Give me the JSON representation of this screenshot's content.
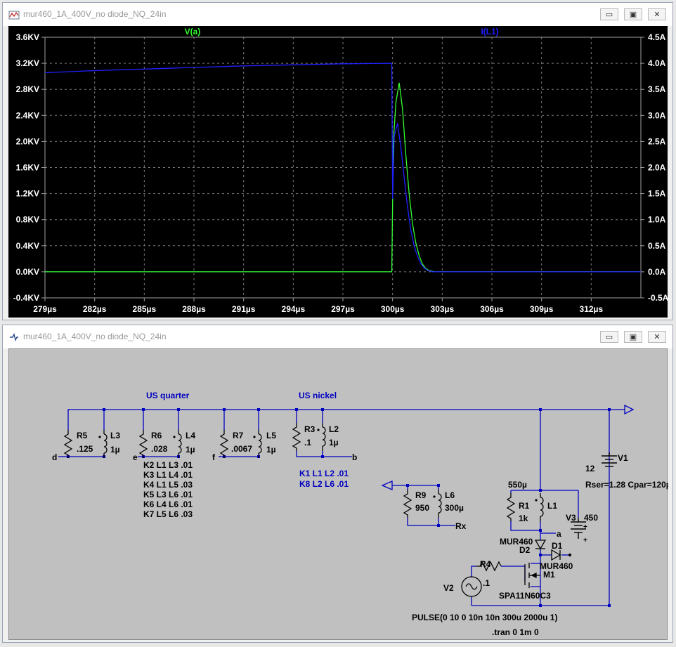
{
  "waveform_window": {
    "title": "mur460_1A_400V_no diode_NQ_24in",
    "buttons": {
      "minimize": "▭",
      "restore": "▣",
      "close": "✕"
    }
  },
  "schematic_window": {
    "title": "mur460_1A_400V_no diode_NQ_24in",
    "buttons": {
      "minimize": "▭",
      "restore": "▣",
      "close": "✕"
    }
  },
  "chart_data": {
    "type": "line",
    "xlabel": "",
    "x_unit": "µs",
    "xlim": [
      279,
      315
    ],
    "x_ticks": [
      "279µs",
      "282µs",
      "285µs",
      "288µs",
      "291µs",
      "294µs",
      "297µs",
      "300µs",
      "303µs",
      "306µs",
      "309µs",
      "312µs"
    ],
    "left_axis": {
      "ylim": [
        -0.4,
        3.6
      ],
      "ticks": [
        "-0.4KV",
        "0.0KV",
        "0.4KV",
        "0.8KV",
        "1.2KV",
        "1.6KV",
        "2.0KV",
        "2.4KV",
        "2.8KV",
        "3.2KV",
        "3.6KV"
      ]
    },
    "right_axis": {
      "ylim": [
        -0.5,
        4.5
      ],
      "ticks": [
        "-0.5A",
        "0.0A",
        "0.5A",
        "1.0A",
        "1.5A",
        "2.0A",
        "2.5A",
        "3.0A",
        "3.5A",
        "4.0A",
        "4.5A"
      ]
    },
    "grid": true,
    "series": [
      {
        "name": "V(a)",
        "color": "#33ff33",
        "axis": "left",
        "unit": "KV",
        "points": [
          [
            279,
            0
          ],
          [
            299.95,
            0
          ],
          [
            300.05,
            2.0
          ],
          [
            300.2,
            2.6
          ],
          [
            300.4,
            2.9
          ],
          [
            300.6,
            2.5
          ],
          [
            300.8,
            1.8
          ],
          [
            301.0,
            1.2
          ],
          [
            301.2,
            0.75
          ],
          [
            301.4,
            0.45
          ],
          [
            301.6,
            0.25
          ],
          [
            301.8,
            0.12
          ],
          [
            302.0,
            0.05
          ],
          [
            302.2,
            0.02
          ],
          [
            302.5,
            0
          ],
          [
            315,
            0
          ]
        ]
      },
      {
        "name": "I(L1)",
        "color": "#2020ff",
        "axis": "right",
        "unit": "A",
        "points": [
          [
            279,
            3.82
          ],
          [
            282,
            3.86
          ],
          [
            285,
            3.89
          ],
          [
            288,
            3.92
          ],
          [
            291,
            3.95
          ],
          [
            294,
            3.97
          ],
          [
            297,
            3.99
          ],
          [
            299.95,
            4.0
          ],
          [
            300.0,
            1.4
          ],
          [
            300.1,
            2.6
          ],
          [
            300.3,
            2.85
          ],
          [
            300.5,
            2.4
          ],
          [
            300.7,
            1.8
          ],
          [
            300.9,
            1.25
          ],
          [
            301.1,
            0.8
          ],
          [
            301.3,
            0.5
          ],
          [
            301.5,
            0.3
          ],
          [
            301.7,
            0.16
          ],
          [
            301.9,
            0.08
          ],
          [
            302.1,
            0.03
          ],
          [
            302.4,
            0
          ],
          [
            315,
            0
          ]
        ]
      }
    ]
  },
  "schematic": {
    "wire_color": "#0000c0",
    "comments": {
      "us_quarter": "US quarter",
      "us_nickel": "US nickel"
    },
    "components": {
      "R5": {
        "name": "R5",
        "value": ".125"
      },
      "L3": {
        "name": "L3",
        "value": "1µ"
      },
      "R6": {
        "name": "R6",
        "value": ".028"
      },
      "L4": {
        "name": "L4",
        "value": "1µ"
      },
      "R7": {
        "name": "R7",
        "value": ".0067"
      },
      "L5": {
        "name": "L5",
        "value": "1µ"
      },
      "R3": {
        "name": "R3",
        "value": ".1"
      },
      "L2": {
        "name": "L2",
        "value": "1µ"
      },
      "R9": {
        "name": "R9",
        "value": "950"
      },
      "L6": {
        "name": "L6",
        "value": "300µ"
      },
      "R1": {
        "name": "R1",
        "value": "1k"
      },
      "L1": {
        "name": "L1",
        "value": "550µ"
      },
      "V1": {
        "name": "V1",
        "value": "12"
      },
      "V3": {
        "name": "V3",
        "value": "450"
      },
      "D1": {
        "name": "D1",
        "value": "MUR460"
      },
      "D2": {
        "name": "D2",
        "value": "MUR460"
      },
      "M1": {
        "name": "M1",
        "value": "SPA11N60C3"
      },
      "R4": {
        "name": "R4",
        "value": ".1"
      },
      "V2": {
        "name": "V2",
        "value": "PULSE(0 10 0 10n 10n 300u 2000u 1)"
      }
    },
    "nets": {
      "d": "d",
      "e": "e",
      "f": "f",
      "b": "b",
      "a": "a",
      "rx": "Rx"
    },
    "k_black": [
      "K2 L1 L3 .01",
      "K3 L1 L4 .01",
      "K4 L1 L5 .03",
      "K5 L3 L6 .01",
      "K6 L4 L6 .01",
      "K7 L5 L6 .03"
    ],
    "k_blue": [
      "K1 L1 L2 .01",
      "K8 L2 L6 .01"
    ],
    "rser_cpar": "Rser=1.28 Cpar=120p",
    "tran": ".tran 0 1m 0"
  }
}
